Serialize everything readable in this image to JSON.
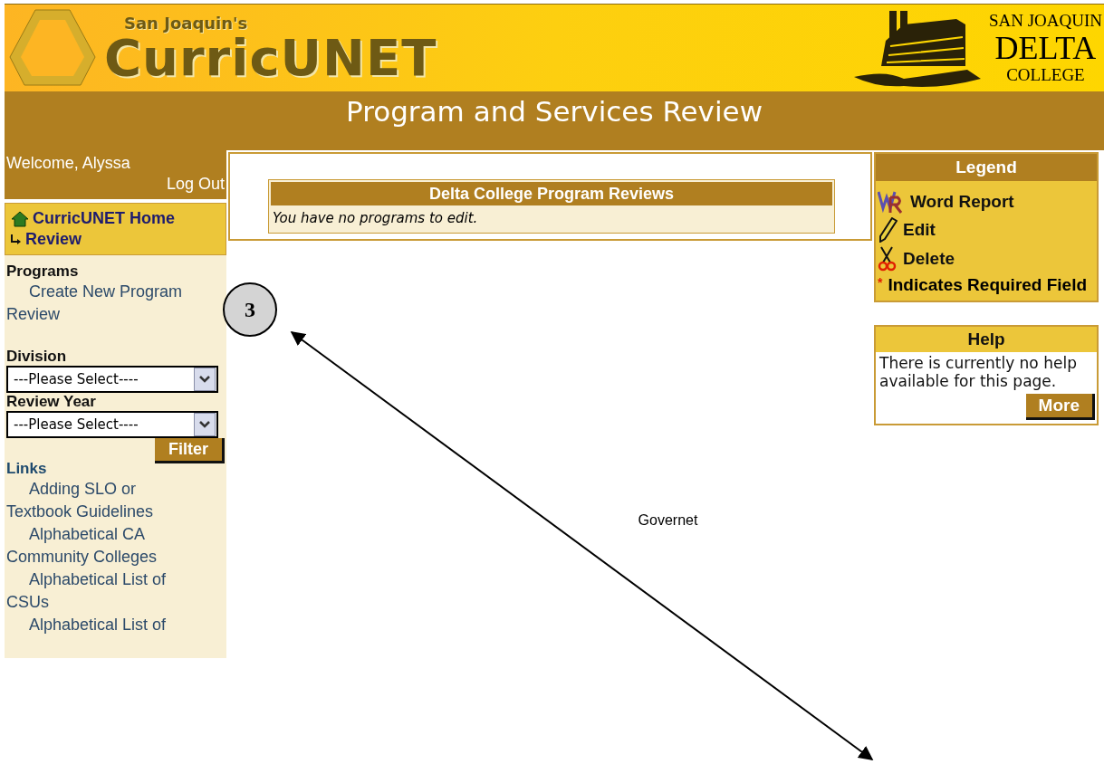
{
  "header": {
    "logo_small": "San Joaquin's",
    "logo_big": "CurricUNET",
    "college_lines": [
      "SAN JOAQUIN",
      "DELTA",
      "COLLEGE"
    ]
  },
  "title_bar": {
    "title": "Program and Services Review"
  },
  "user": {
    "welcome": "Welcome, Alyssa",
    "logout": "Log Out"
  },
  "breadcrumb": [
    {
      "label": "CurricUNET Home",
      "kind": "home"
    },
    {
      "label": "Review",
      "kind": "child"
    }
  ],
  "programs": {
    "heading": "Programs",
    "links": [
      "Create New Program Review"
    ]
  },
  "filters": [
    {
      "label": "Division",
      "value": "---Please Select----"
    },
    {
      "label": "Review Year",
      "value": "---Please Select----"
    }
  ],
  "filter_button": "Filter",
  "links": {
    "heading": "Links",
    "items": [
      "Adding SLO or Textbook Guidelines",
      "Alphabetical CA Community Colleges",
      "Alphabetical List of CSUs",
      "Alphabetical List of"
    ]
  },
  "reviews_table": {
    "title": "Delta College Program Reviews",
    "message": "You have no programs to edit."
  },
  "footer_text": "Governet",
  "legend": {
    "title": "Legend",
    "items": [
      {
        "kind": "word",
        "label": "Word Report"
      },
      {
        "kind": "edit",
        "label": "Edit"
      },
      {
        "kind": "delete",
        "label": "Delete"
      },
      {
        "kind": "required",
        "mark": "*",
        "label": "Indicates Required Field"
      }
    ]
  },
  "help": {
    "title": "Help",
    "text": "There is currently no help available for this page.",
    "button": "More"
  },
  "annotation": {
    "number": "3"
  }
}
